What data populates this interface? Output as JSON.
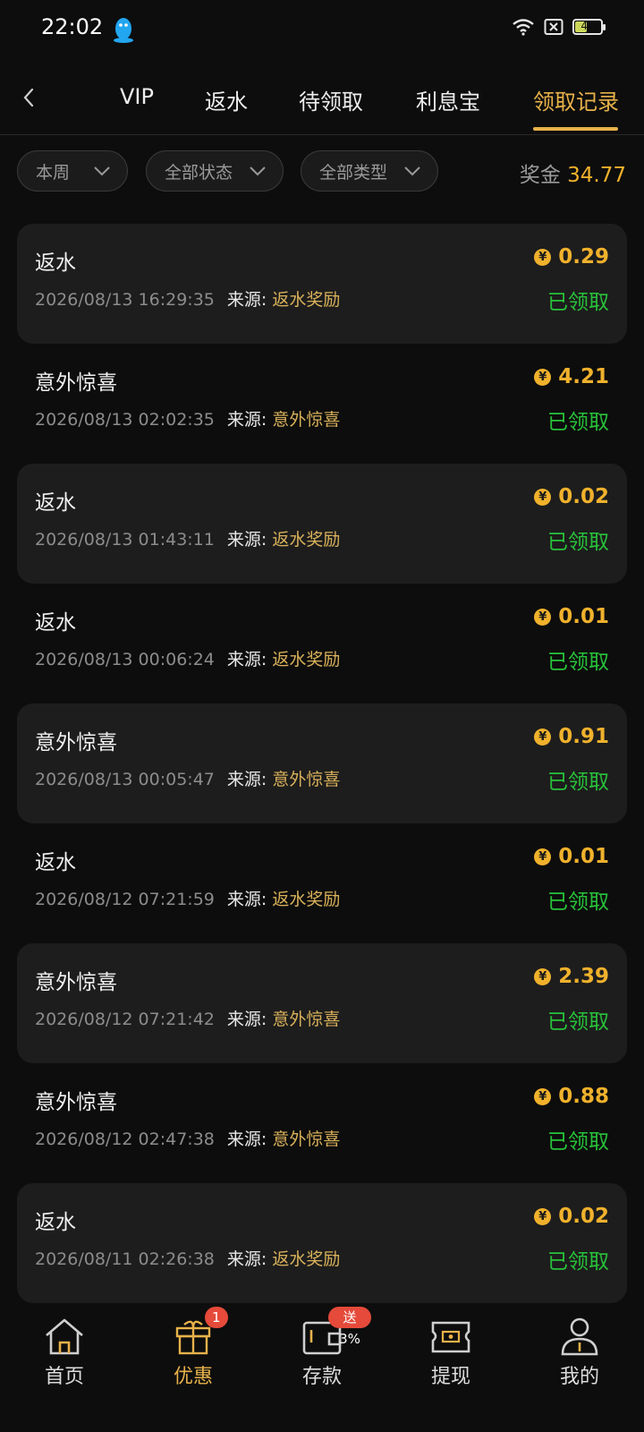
{
  "status_bar": {
    "time": "22:02",
    "battery": "45"
  },
  "tabs": [
    {
      "label": "VIP"
    },
    {
      "label": "返水"
    },
    {
      "label": "待领取"
    },
    {
      "label": "利息宝"
    },
    {
      "label": "领取记录"
    }
  ],
  "active_tab": "领取记录",
  "filters": {
    "period": "本周",
    "status": "全部状态",
    "type": "全部类型"
  },
  "bonus": {
    "label": "奖金",
    "value": "34.77"
  },
  "source_label": "来源:",
  "records": [
    {
      "title": "返水",
      "time": "2026/08/13 16:29:35",
      "source": "返水奖励",
      "amount": "0.29",
      "status": "已领取"
    },
    {
      "title": "意外惊喜",
      "time": "2026/08/13 02:02:35",
      "source": "意外惊喜",
      "amount": "4.21",
      "status": "已领取"
    },
    {
      "title": "返水",
      "time": "2026/08/13 01:43:11",
      "source": "返水奖励",
      "amount": "0.02",
      "status": "已领取"
    },
    {
      "title": "返水",
      "time": "2026/08/13 00:06:24",
      "source": "返水奖励",
      "amount": "0.01",
      "status": "已领取"
    },
    {
      "title": "意外惊喜",
      "time": "2026/08/13 00:05:47",
      "source": "意外惊喜",
      "amount": "0.91",
      "status": "已领取"
    },
    {
      "title": "返水",
      "time": "2026/08/12 07:21:59",
      "source": "返水奖励",
      "amount": "0.01",
      "status": "已领取"
    },
    {
      "title": "意外惊喜",
      "time": "2026/08/12 07:21:42",
      "source": "意外惊喜",
      "amount": "2.39",
      "status": "已领取"
    },
    {
      "title": "意外惊喜",
      "time": "2026/08/12 02:47:38",
      "source": "意外惊喜",
      "amount": "0.88",
      "status": "已领取"
    },
    {
      "title": "返水",
      "time": "2026/08/11 02:26:38",
      "source": "返水奖励",
      "amount": "0.02",
      "status": "已领取"
    }
  ],
  "bottom_nav": [
    {
      "label": "首页",
      "icon": "home-icon"
    },
    {
      "label": "优惠",
      "icon": "gift-icon",
      "badge": "1"
    },
    {
      "label": "存款",
      "icon": "wallet-icon",
      "badge": "送3%"
    },
    {
      "label": "提现",
      "icon": "withdraw-ticket-icon"
    },
    {
      "label": "我的",
      "icon": "user-icon"
    }
  ],
  "colors": {
    "accent": "#e8b24a",
    "amount": "#f0b12c",
    "claimed": "#28c23a",
    "badge": "#e54a3a"
  }
}
